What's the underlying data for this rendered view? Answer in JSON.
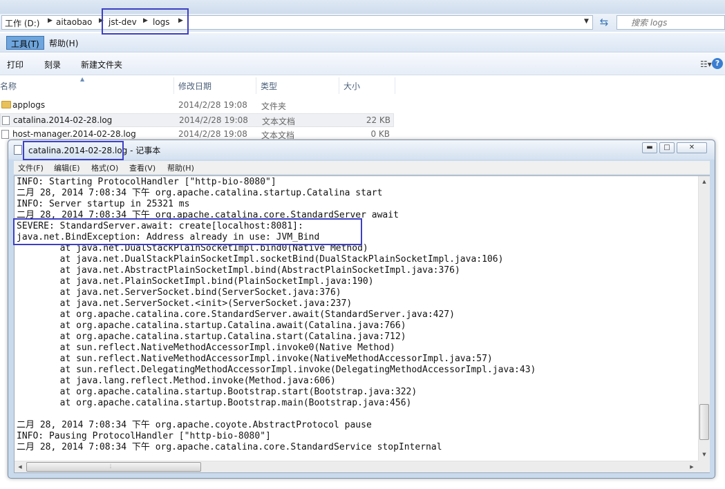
{
  "explorer": {
    "breadcrumb": [
      "工作 (D:)",
      "aitaobao",
      "jst-dev",
      "logs"
    ],
    "search_placeholder": "搜索 logs",
    "menu": {
      "tools": "工具(T)",
      "help": "帮助(H)"
    },
    "commands": [
      "打印",
      "刻录",
      "新建文件夹"
    ],
    "columns": {
      "name": "名称",
      "date": "修改日期",
      "type": "类型",
      "size": "大小"
    },
    "files": [
      {
        "name": "applogs",
        "date": "2014/2/28 19:08",
        "type": "文件夹",
        "size": "",
        "kind": "folder"
      },
      {
        "name": "catalina.2014-02-28.log",
        "date": "2014/2/28 19:08",
        "type": "文本文档",
        "size": "22 KB",
        "kind": "doc",
        "selected": true
      },
      {
        "name": "host-manager.2014-02-28.log",
        "date": "2014/2/28 19:08",
        "type": "文本文档",
        "size": "0 KB",
        "kind": "doc"
      }
    ]
  },
  "notepad": {
    "file_name": "catalina.2014-02-28.log",
    "title_suffix": " - 记事本",
    "window_buttons": {
      "minimize": "▬",
      "maximize": "□",
      "close": "✕"
    },
    "menu": [
      "文件(F)",
      "编辑(E)",
      "格式(O)",
      "查看(V)",
      "帮助(H)"
    ],
    "lines": [
      "INFO: Starting ProtocolHandler [\"http-bio-8080\"]",
      "二月 28, 2014 7:08:34 下午 org.apache.catalina.startup.Catalina start",
      "INFO: Server startup in 25321 ms",
      "二月 28, 2014 7:08:34 下午 org.apache.catalina.core.StandardServer await",
      "SEVERE: StandardServer.await: create[localhost:8081]:",
      "java.net.BindException: Address already in use: JVM_Bind",
      "        at java.net.DualStackPlainSocketImpl.bind0(Native Method)",
      "        at java.net.DualStackPlainSocketImpl.socketBind(DualStackPlainSocketImpl.java:106)",
      "        at java.net.AbstractPlainSocketImpl.bind(AbstractPlainSocketImpl.java:376)",
      "        at java.net.PlainSocketImpl.bind(PlainSocketImpl.java:190)",
      "        at java.net.ServerSocket.bind(ServerSocket.java:376)",
      "        at java.net.ServerSocket.<init>(ServerSocket.java:237)",
      "        at org.apache.catalina.core.StandardServer.await(StandardServer.java:427)",
      "        at org.apache.catalina.startup.Catalina.await(Catalina.java:766)",
      "        at org.apache.catalina.startup.Catalina.start(Catalina.java:712)",
      "        at sun.reflect.NativeMethodAccessorImpl.invoke0(Native Method)",
      "        at sun.reflect.NativeMethodAccessorImpl.invoke(NativeMethodAccessorImpl.java:57)",
      "        at sun.reflect.DelegatingMethodAccessorImpl.invoke(DelegatingMethodAccessorImpl.java:43)",
      "        at java.lang.reflect.Method.invoke(Method.java:606)",
      "        at org.apache.catalina.startup.Bootstrap.start(Bootstrap.java:322)",
      "        at org.apache.catalina.startup.Bootstrap.main(Bootstrap.java:456)",
      "",
      "二月 28, 2014 7:08:34 下午 org.apache.coyote.AbstractProtocol pause",
      "INFO: Pausing ProtocolHandler [\"http-bio-8080\"]",
      "二月 28, 2014 7:08:34 下午 org.apache.catalina.core.StandardService stopInternal"
    ]
  },
  "colors": {
    "highlight_border": "#3d3fc4",
    "selected_menu": "#6ea5dc"
  }
}
